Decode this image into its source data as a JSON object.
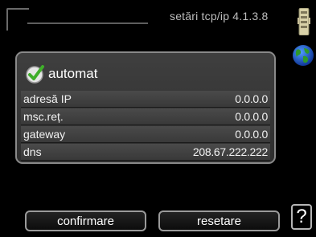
{
  "header": {
    "title": "setări tcp/ip",
    "menu_number": "4.1.3.8",
    "router_icon": "router-icon",
    "globe_icon": "globe-icon"
  },
  "settings": {
    "auto": {
      "label": "automat",
      "checked": true,
      "icon": "checkmark-icon"
    },
    "rows": [
      {
        "label": "adresă IP",
        "value": "0.0.0.0"
      },
      {
        "label": "msc.reț.",
        "value": "0.0.0.0"
      },
      {
        "label": "gateway",
        "value": "0.0.0.0"
      },
      {
        "label": "dns",
        "value": "208.67.222.222"
      }
    ]
  },
  "footer": {
    "confirm_label": "confirmare",
    "reset_label": "resetare",
    "help_label": "?"
  },
  "colors": {
    "background": "#000000",
    "panel": "#3a3a3a",
    "check_green": "#3fae2a"
  }
}
